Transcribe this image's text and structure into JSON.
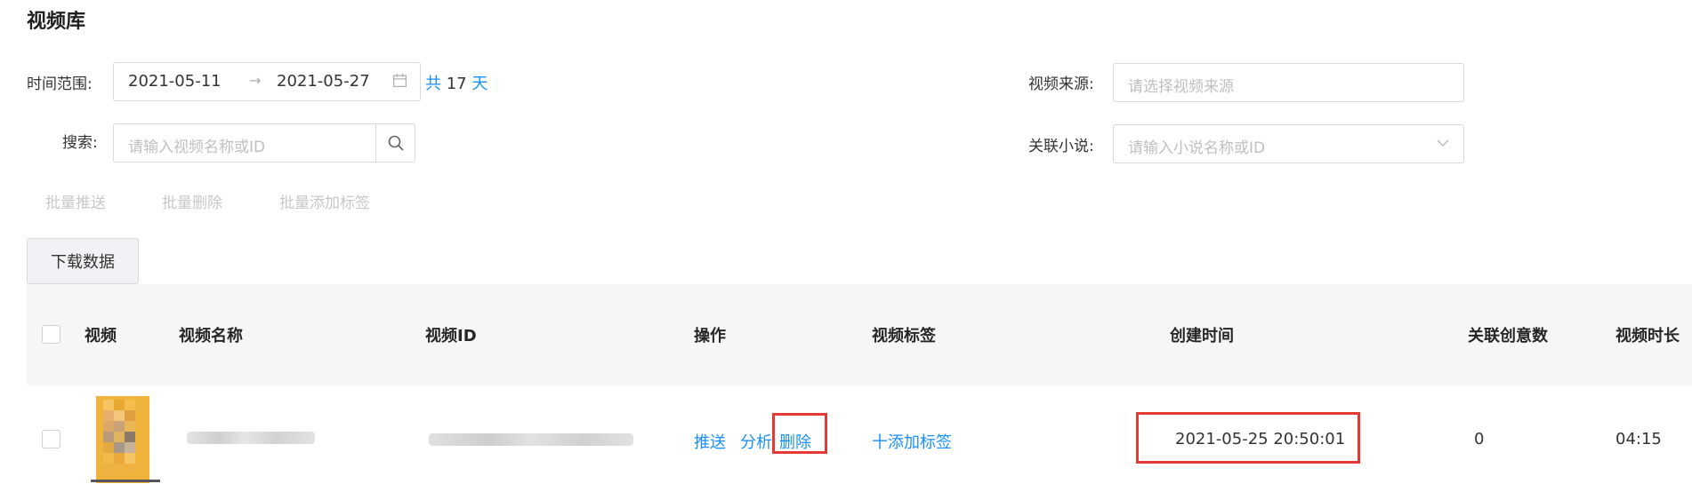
{
  "page": {
    "title": "视频库"
  },
  "filters": {
    "date_range_label": "时间范围:",
    "start_date": "2021-05-11",
    "range_arrow": "→",
    "end_date": "2021-05-27",
    "day_count_prefix": "共",
    "day_count": "17",
    "day_count_suffix": "天",
    "search_label": "搜索:",
    "search_placeholder": "请输入视频名称或ID",
    "source_label": "视频来源:",
    "source_placeholder": "请选择视频来源",
    "novel_label": "关联小说:",
    "novel_placeholder": "请输入小说名称或ID"
  },
  "batch_actions": [
    "批量推送",
    "批量删除",
    "批量添加标签"
  ],
  "toolbar": {
    "download_label": "下载数据"
  },
  "table": {
    "columns": [
      "视频",
      "视频名称",
      "视频ID",
      "操作",
      "视频标签",
      "创建时间",
      "关联创意数",
      "视频时长"
    ],
    "rows": [
      {
        "actions": [
          "推送",
          "分析",
          "删除"
        ],
        "tag_action": "十添加标签",
        "created_at": "2021-05-25 20:50:01",
        "creative_count": "0",
        "duration": "04:15"
      }
    ]
  },
  "colors": {
    "link": "#1890ff",
    "highlight": "#e53935",
    "header_bg": "#f5f6f7",
    "thumb_primary": "#f0b43c"
  },
  "icons": {
    "date_picker": "calendar-icon",
    "search": "search-icon",
    "select": "chevron-down-icon"
  }
}
